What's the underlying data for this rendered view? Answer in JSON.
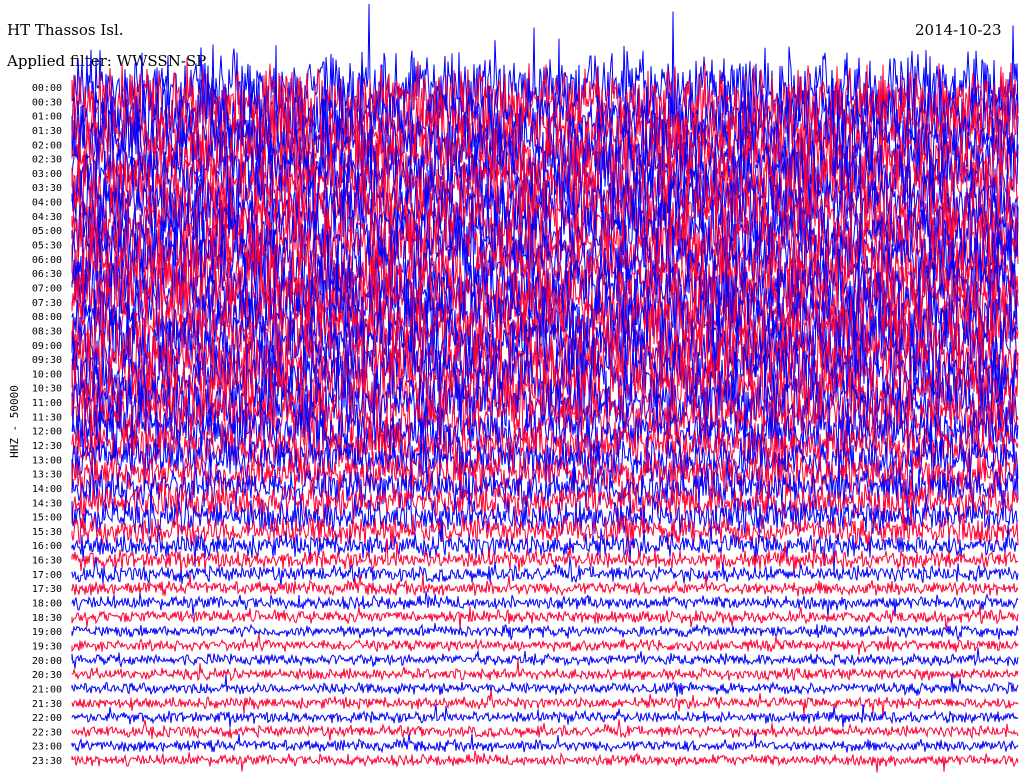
{
  "chart_data": {
    "type": "line",
    "title": "HT Thassos Isl.",
    "subtitle": "Applied filter: WWSSN-SP",
    "date": "2014-10-23",
    "ylabel": "HHZ - 50000",
    "row_labels": [
      "00:00",
      "00:30",
      "01:00",
      "01:30",
      "02:00",
      "02:30",
      "03:00",
      "03:30",
      "04:00",
      "04:30",
      "05:00",
      "05:30",
      "06:00",
      "06:30",
      "07:00",
      "07:30",
      "08:00",
      "08:30",
      "09:00",
      "09:30",
      "10:00",
      "10:30",
      "11:00",
      "11:30",
      "12:00",
      "12:30",
      "13:00",
      "13:30",
      "14:00",
      "14:30",
      "15:00",
      "15:30",
      "16:00",
      "16:30",
      "17:00",
      "17:30",
      "18:00",
      "18:30",
      "19:00",
      "19:30",
      "20:00",
      "20:30",
      "21:00",
      "21:30",
      "22:00",
      "22:30",
      "23:00",
      "23:30"
    ],
    "series_colors": [
      "#0000ff",
      "#ff0033"
    ],
    "relative_amplitude_by_row": [
      3,
      3,
      3,
      3,
      3,
      3,
      3,
      3,
      3,
      3,
      3,
      3,
      3,
      3,
      3,
      3,
      3,
      3,
      3,
      3,
      3,
      2.8,
      2.6,
      2.4,
      2.2,
      2,
      1.9,
      1.8,
      1.7,
      1.6,
      1.5,
      1.3,
      1,
      0.8,
      0.7,
      0.6,
      0.6,
      0.55,
      0.5,
      0.5,
      0.5,
      0.5,
      0.5,
      0.5,
      0.5,
      0.5,
      0.5,
      0.5
    ]
  }
}
